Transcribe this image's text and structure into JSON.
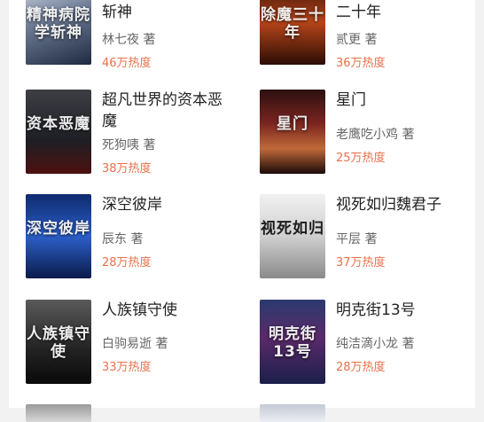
{
  "books": [
    {
      "title": "…我在精神病院学斩神",
      "author": "林七夜",
      "author_suffix": "著",
      "heat": "46万热度",
      "cover_text": "精神病院学斩神"
    },
    {
      "title": "…我在镇妖司苟到二十年",
      "author": "贰更",
      "author_suffix": "著",
      "heat": "36万热度",
      "cover_text": "除魔三十年"
    },
    {
      "title": "超凡世界的资本恶魔",
      "author": "死狗咦",
      "author_suffix": "著",
      "heat": "38万热度",
      "cover_text": "资本恶魔"
    },
    {
      "title": "星门",
      "author": "老鹰吃小鸡",
      "author_suffix": "著",
      "heat": "25万热度",
      "cover_text": "星门"
    },
    {
      "title": "深空彼岸",
      "author": "辰东",
      "author_suffix": "著",
      "heat": "28万热度",
      "cover_text": "深空彼岸"
    },
    {
      "title": "视死如归魏君子",
      "author": "平层",
      "author_suffix": "著",
      "heat": "37万热度",
      "cover_text": "视死如归"
    },
    {
      "title": "人族镇守使",
      "author": "白驹易逝",
      "author_suffix": "著",
      "heat": "33万热度",
      "cover_text": "人族镇守使"
    },
    {
      "title": "明克街13号",
      "author": "纯洁滴小龙",
      "author_suffix": "著",
      "heat": "28万热度",
      "cover_text": "明克街13号"
    }
  ]
}
